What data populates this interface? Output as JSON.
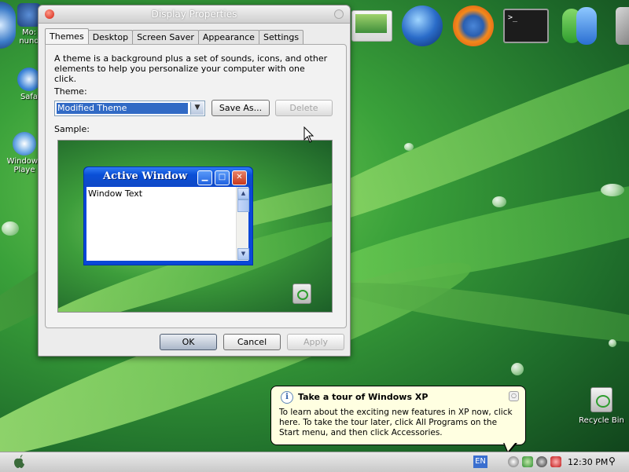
{
  "desktop": {
    "left_icons": [
      {
        "label_lines": [
          "Mo:",
          "nund"
        ]
      },
      {
        "label_lines": [
          "Safa"
        ]
      },
      {
        "label_lines": [
          "Windows",
          "Playe"
        ]
      }
    ],
    "recycle_bin_label": "Recycle Bin"
  },
  "dialog": {
    "title": "Display Properties",
    "tabs": [
      "Themes",
      "Desktop",
      "Screen Saver",
      "Appearance",
      "Settings"
    ],
    "active_tab": "Themes",
    "description": "A theme is a background plus a set of sounds, icons, and other elements to help you personalize your computer with one click.",
    "theme_label": "Theme:",
    "theme_value": "Modified Theme",
    "save_as_label": "Save As...",
    "delete_label": "Delete",
    "sample_label": "Sample:",
    "sample_window": {
      "title": "Active Window",
      "text": "Window Text"
    },
    "ok_label": "OK",
    "cancel_label": "Cancel",
    "apply_label": "Apply"
  },
  "balloon": {
    "title": "Take a tour of Windows XP",
    "body": "To learn about the exciting new features in XP now, click here. To take the tour later, click All Programs on the Start menu, and then click Accessories."
  },
  "taskbar": {
    "language": "EN",
    "clock": "12:30 PM"
  }
}
